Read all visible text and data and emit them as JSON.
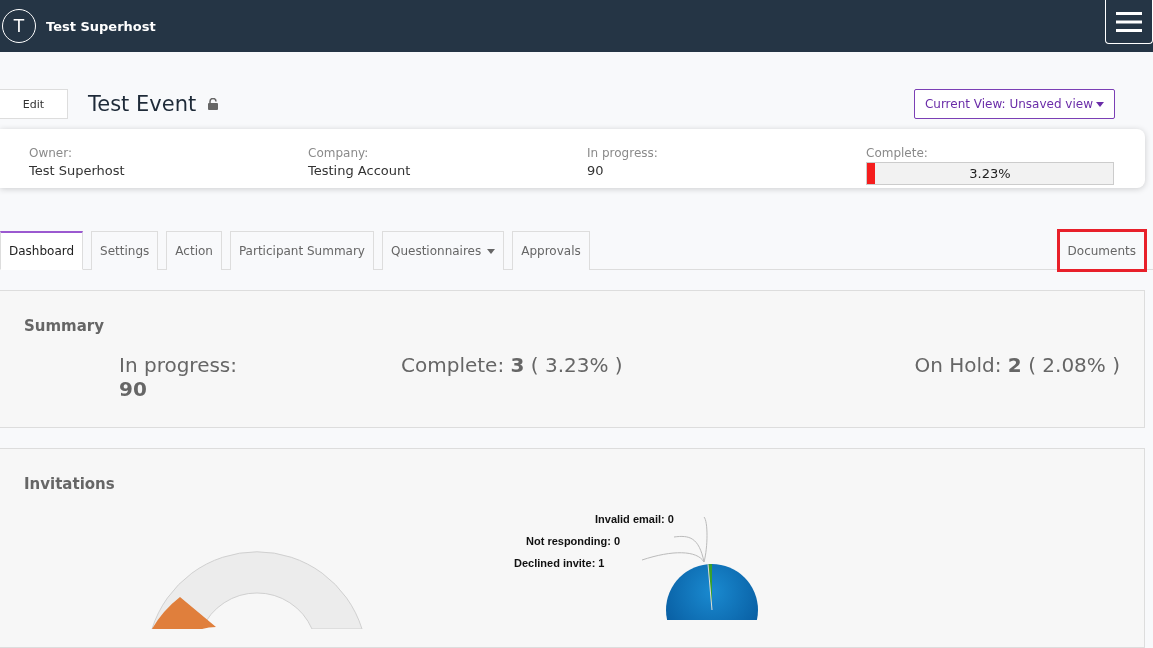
{
  "header": {
    "avatar_letter": "T",
    "user_name": "Test Superhost"
  },
  "event": {
    "edit_button": "Edit",
    "title": "Test Event",
    "locked": false,
    "view_button": "Current View: Unsaved view"
  },
  "info": [
    {
      "kind": "text",
      "label": "Owner:",
      "value": "Test Superhost"
    },
    {
      "kind": "text",
      "label": "Company:",
      "value": "Testing Account"
    },
    {
      "kind": "text",
      "label": "In progress:",
      "value": "90"
    },
    {
      "kind": "progress",
      "label": "Complete:",
      "value": "3.23%",
      "level": 0.0323
    }
  ],
  "tabs": [
    {
      "label": "Dashboard",
      "selected": true,
      "dropdown": false,
      "highlighted": false
    },
    {
      "label": "Settings",
      "selected": false,
      "dropdown": false,
      "highlighted": false
    },
    {
      "label": "Action",
      "selected": false,
      "dropdown": false,
      "highlighted": false
    },
    {
      "label": "Participant Summary",
      "selected": false,
      "dropdown": false,
      "highlighted": false
    },
    {
      "label": "Questionnaires",
      "selected": false,
      "dropdown": true,
      "highlighted": false
    },
    {
      "label": "Approvals",
      "selected": false,
      "dropdown": false,
      "highlighted": false
    },
    {
      "label": "Documents",
      "selected": false,
      "dropdown": false,
      "highlighted": true
    }
  ],
  "summary": {
    "title": "Summary",
    "stats": [
      "In progress: **90**",
      "Complete: **3** ( 3.23% )",
      "On Hold: **2** ( 2.08% )"
    ]
  },
  "invitations": {
    "title": "Invitations",
    "pie_labels": [
      "Invalid email: 0",
      "Not responding: 0",
      "Declined invite: 1"
    ]
  }
}
